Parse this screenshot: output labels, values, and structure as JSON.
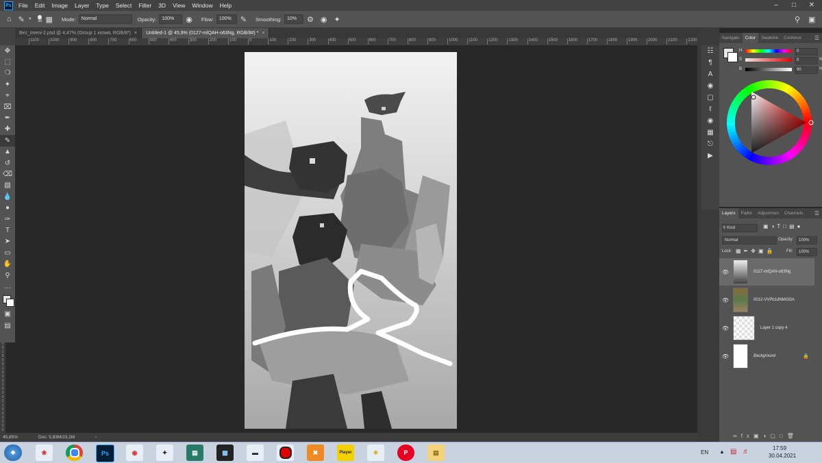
{
  "menu": {
    "app_logo": "Ps",
    "items": [
      "File",
      "Edit",
      "Image",
      "Layer",
      "Type",
      "Select",
      "Filter",
      "3D",
      "View",
      "Window",
      "Help"
    ]
  },
  "options": {
    "brush_size": "36",
    "mode_label": "Mode:",
    "mode_value": "Normal",
    "opacity_label": "Opacity:",
    "opacity_value": "100%",
    "flow_label": "Flow:",
    "flow_value": "100%",
    "smoothing_label": "Smoothing:",
    "smoothing_value": "10%"
  },
  "tabs": [
    {
      "label": "Bez_imeni-2.psd @ 4,47% (Group 1 копия, RGB/8*)",
      "active": false
    },
    {
      "label": "Untitled-1 @ 45,9% (0127-mlQAH-o63Ng, RGB/8#) *",
      "active": true
    }
  ],
  "ruler_ticks": [
    "1100",
    "1000",
    "900",
    "800",
    "700",
    "600",
    "500",
    "400",
    "300",
    "200",
    "100",
    "0",
    "100",
    "200",
    "300",
    "400",
    "500",
    "600",
    "700",
    "800",
    "900",
    "1000",
    "1100",
    "1200",
    "1300",
    "1400",
    "1500",
    "1600",
    "1700",
    "1800",
    "1900",
    "2000",
    "2100",
    "2200"
  ],
  "vruler_ticks": [
    "1",
    "5",
    "0",
    "0",
    "1",
    "6",
    "0",
    "0",
    "1",
    "7",
    "0",
    "0",
    "1",
    "8",
    "0",
    "0",
    "1",
    "9",
    "0",
    "0",
    "2",
    "0",
    "0",
    "0",
    "2",
    "1",
    "0",
    "0",
    "2",
    "2",
    "0",
    "0"
  ],
  "status": {
    "zoom": "45,85%",
    "doc": "Doc: 5,93M/23,1M"
  },
  "color_panel": {
    "tabs": [
      "Navigato",
      "Color",
      "Swatche",
      "Coolorus"
    ],
    "active_tab": "Color",
    "h_label": "H",
    "h_value": "0",
    "s_label": "S",
    "s_value": "0",
    "s_unit": "%",
    "b_label": "B",
    "b_value": "90",
    "b_unit": "%"
  },
  "layers_panel": {
    "tabs": [
      "Layers",
      "Paths",
      "Adjustmen",
      "Channels"
    ],
    "active_tab": "Layers",
    "filter_kind": "Kind",
    "blend_mode": "Normal",
    "opacity_label": "Opacity:",
    "opacity_value": "100%",
    "lock_label": "Lock:",
    "fill_label": "Fill:",
    "fill_value": "100%",
    "layers": [
      {
        "name": "0127-mlQAH-o63Ng",
        "selected": true
      },
      {
        "name": "0012-VVPb1dNMOGA",
        "selected": false
      },
      {
        "name": "Layer 1 copy 4",
        "selected": false
      },
      {
        "name": "Background",
        "selected": false
      }
    ]
  },
  "taskbar": {
    "language": "EN",
    "time": "17:59",
    "date": "30.04.2021",
    "player_label": "Player",
    "ps_label": "Ps"
  },
  "colors": {
    "accent": "#31a8ff",
    "panel_bg": "#535353",
    "workspace_bg": "#282828"
  }
}
